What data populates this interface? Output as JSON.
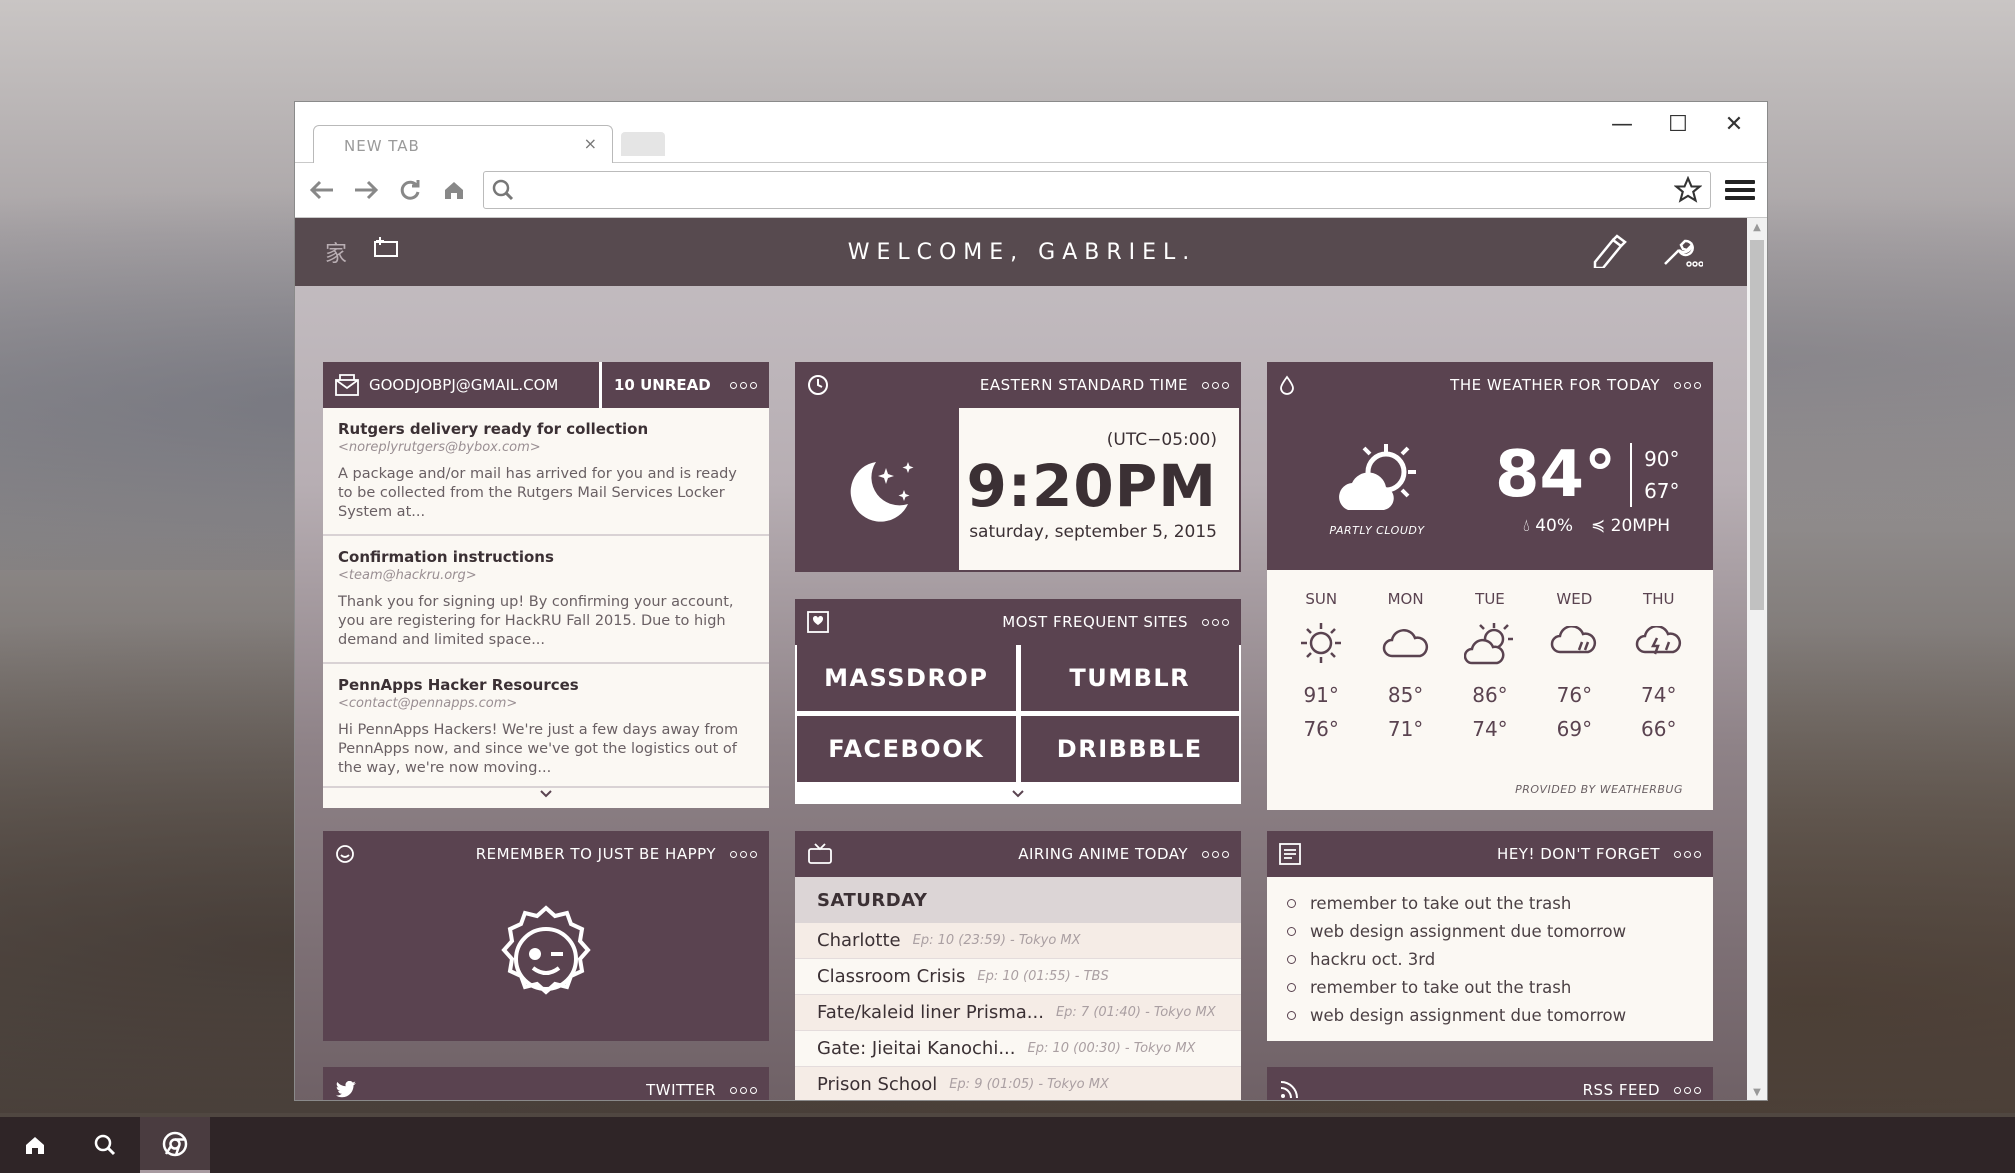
{
  "browser": {
    "tab_title": "NEW TAB",
    "tab_close": "×",
    "url_value": "",
    "url_placeholder": "",
    "window_controls": {
      "minimize": "—",
      "maximize": "☐",
      "close": "✕"
    }
  },
  "header": {
    "title": "WELCOME, GABRIEL.",
    "home_glyph": "家"
  },
  "email": {
    "address": "GOODJOBPJ@GMAIL.COM",
    "unread": "10 UNREAD",
    "items": [
      {
        "subject": "Rutgers delivery ready for collection",
        "from": "<noreplyrutgers@bybox.com>",
        "body": "A package and/or mail has arrived for you and is ready to be collected from the Rutgers Mail Services Locker System at..."
      },
      {
        "subject": "Confirmation instructions",
        "from": "<team@hackru.org>",
        "body": "Thank you for signing up! By confirming your account, you are registering for HackRU Fall 2015. Due to high demand and limited space..."
      },
      {
        "subject": "PennApps Hacker Resources",
        "from": "<contact@pennapps.com>",
        "body": "Hi PennApps Hackers! We're just a few days away from PennApps now, and since we've got the logistics out of the way, we're now moving..."
      }
    ]
  },
  "clock": {
    "title": "EASTERN STANDARD TIME",
    "offset": "(UTC−05:00)",
    "time": "9:20PM",
    "date": "saturday, september 5, 2015"
  },
  "sites": {
    "title": "MOST FREQUENT SITES",
    "items": [
      "MASSDROP",
      "TUMBLR",
      "FACEBOOK",
      "DRIBBBLE"
    ]
  },
  "weather": {
    "title": "THE WEATHER FOR TODAY",
    "condition": "PARTLY CLOUDY",
    "temp": "84°",
    "high": "90°",
    "low": "67°",
    "humidity": "40%",
    "wind": "20MPH",
    "forecast": [
      {
        "day": "SUN",
        "icon": "sun-icon",
        "hi": "91°",
        "lo": "76°"
      },
      {
        "day": "MON",
        "icon": "cloud-icon",
        "hi": "85°",
        "lo": "71°"
      },
      {
        "day": "TUE",
        "icon": "partly-cloudy-icon",
        "hi": "86°",
        "lo": "74°"
      },
      {
        "day": "WED",
        "icon": "rain-cloud-icon",
        "hi": "76°",
        "lo": "69°"
      },
      {
        "day": "THU",
        "icon": "storm-cloud-icon",
        "hi": "74°",
        "lo": "66°"
      }
    ],
    "credit": "PROVIDED BY WEATHERBUG"
  },
  "happy": {
    "title": "REMEMBER TO JUST BE HAPPY"
  },
  "anime": {
    "title": "AIRING ANIME TODAY",
    "day": "SATURDAY",
    "items": [
      {
        "title": "Charlotte",
        "meta": "Ep: 10 (23:59) - Tokyo MX"
      },
      {
        "title": "Classroom Crisis",
        "meta": "Ep: 10 (01:55) - TBS"
      },
      {
        "title": "Fate/kaleid liner Prisma...",
        "meta": "Ep: 7 (01:40) - Tokyo MX"
      },
      {
        "title": "Gate: Jieitai Kanochi...",
        "meta": "Ep: 10 (00:30) - Tokyo MX"
      },
      {
        "title": "Prison School",
        "meta": "Ep: 9 (01:05) - Tokyo MX"
      }
    ]
  },
  "todo": {
    "title": "HEY! DON'T FORGET",
    "items": [
      "remember to take out the trash",
      "web design assignment due tomorrow",
      "hackru oct. 3rd",
      "remember to take out the trash",
      "web design assignment due tomorrow"
    ]
  },
  "twitter": {
    "title": "TWITTER"
  },
  "rss": {
    "title": "RSS FEED"
  },
  "colors": {
    "accent": "#5a4350",
    "card": "#fbf8f3",
    "header": "#574a4f"
  }
}
